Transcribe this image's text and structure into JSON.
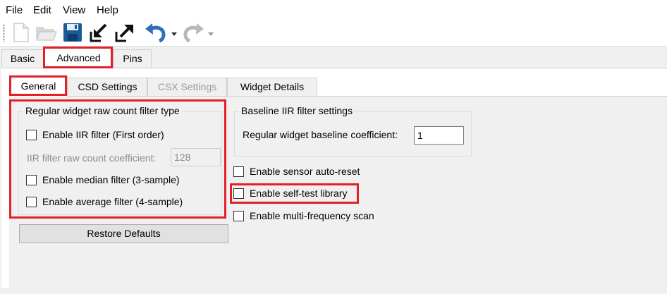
{
  "menu": [
    "File",
    "Edit",
    "View",
    "Help"
  ],
  "toolbar": {
    "icons": [
      "new-file-icon",
      "open-folder-icon",
      "save-icon",
      "import-icon",
      "export-icon",
      "undo-icon",
      "redo-icon"
    ]
  },
  "top_tabs": [
    "Basic",
    "Advanced",
    "Pins"
  ],
  "sub_tabs": [
    "General",
    "CSD Settings",
    "CSX Settings",
    "Widget Details"
  ],
  "raw_filter": {
    "title": "Regular widget raw count filter type",
    "iir_label": "Enable IIR filter (First order)",
    "coef_label": "IIR filter raw count coefficient:",
    "coef_value": "128",
    "median_label": "Enable median filter (3-sample)",
    "average_label": "Enable average filter (4-sample)"
  },
  "restore_label": "Restore Defaults",
  "baseline": {
    "title": "Baseline IIR filter settings",
    "coef_label": "Regular widget baseline coefficient:",
    "coef_value": "1"
  },
  "options": {
    "auto_reset": "Enable sensor auto-reset",
    "self_test": "Enable self-test library",
    "multi_freq": "Enable multi-frequency scan"
  },
  "colors": {
    "highlight": "#e3202a",
    "save_icon": "#1a5b9a",
    "undo_icon": "#2f6fba"
  }
}
